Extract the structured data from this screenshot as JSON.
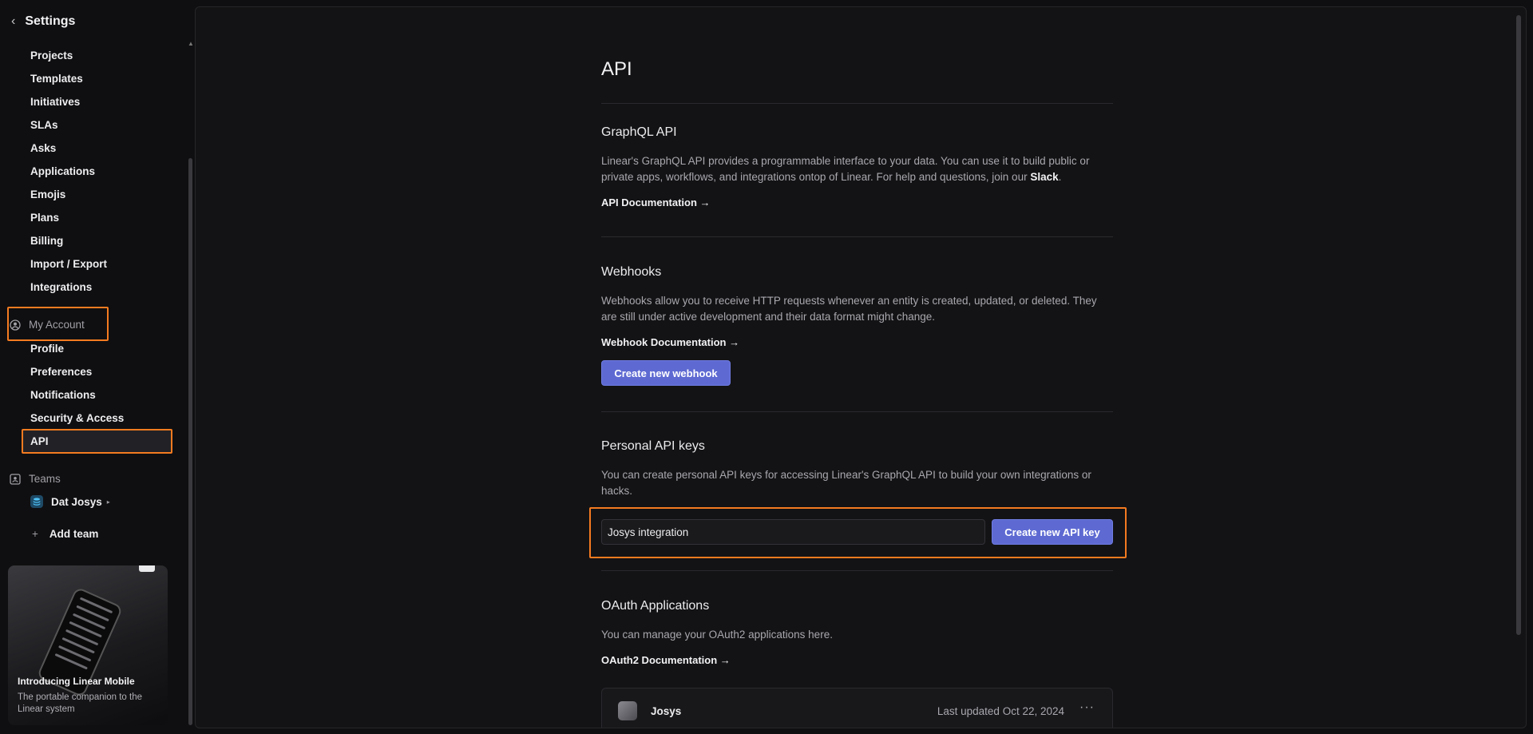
{
  "sidebar": {
    "back_icon": "chevron-left-icon",
    "title": "Settings",
    "workspace_items": [
      "Projects",
      "Templates",
      "Initiatives",
      "SLAs",
      "Asks",
      "Applications",
      "Emojis",
      "Plans",
      "Billing",
      "Import / Export",
      "Integrations"
    ],
    "my_account": {
      "label": "My Account",
      "icon": "user-circle-icon",
      "items": [
        "Profile",
        "Preferences",
        "Notifications",
        "Security & Access",
        "API"
      ],
      "active": "API"
    },
    "teams": {
      "label": "Teams",
      "icon": "team-icon",
      "team_name": "Dat Josys",
      "add_label": "Add team"
    },
    "promo": {
      "title": "Introducing Linear Mobile",
      "subtitle": "The portable companion to the Linear system"
    }
  },
  "main": {
    "title": "API",
    "graphql": {
      "title": "GraphQL API",
      "desc_before": "Linear's GraphQL API provides a programmable interface to your data. You can use it to build public or private apps, workflows, and integrations ontop of Linear. For help and questions, join our ",
      "desc_link": "Slack",
      "desc_after": ".",
      "doc_link": "API Documentation →"
    },
    "webhooks": {
      "title": "Webhooks",
      "desc": "Webhooks allow you to receive HTTP requests whenever an entity is created, updated, or deleted. They are still under active development and their data format might change.",
      "doc_link": "Webhook Documentation →",
      "button": "Create new webhook"
    },
    "personal_keys": {
      "title": "Personal API keys",
      "desc": "You can create personal API keys for accessing Linear's GraphQL API to build your own integrations or hacks.",
      "input_value": "Josys integration",
      "button": "Create new API key"
    },
    "oauth": {
      "title": "OAuth Applications",
      "desc": "You can manage your OAuth2 applications here.",
      "doc_link": "OAuth2 Documentation →",
      "app_name": "Josys",
      "updated": "Last updated Oct 22, 2024",
      "more": "···"
    }
  },
  "colors": {
    "accent": "#5e6ad2",
    "highlight": "#f47b20",
    "background": "#0f0f11"
  }
}
